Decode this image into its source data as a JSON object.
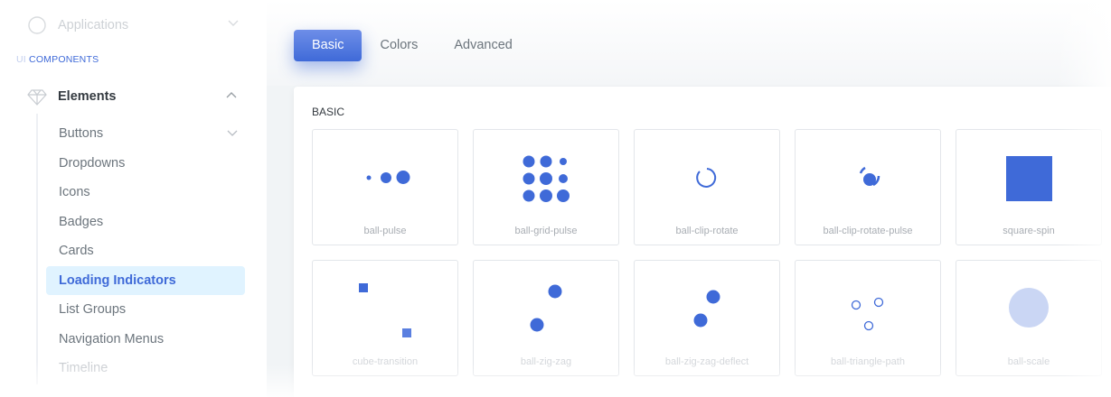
{
  "sidebar": {
    "applications_label": "Applications",
    "section_heading_prefix": "UI ",
    "section_heading_rest": "COMPONENTS",
    "elements_label": "Elements",
    "items": [
      {
        "label": "Buttons"
      },
      {
        "label": "Dropdowns"
      },
      {
        "label": "Icons"
      },
      {
        "label": "Badges"
      },
      {
        "label": "Cards"
      },
      {
        "label": "Loading Indicators"
      },
      {
        "label": "List Groups"
      },
      {
        "label": "Navigation Menus"
      },
      {
        "label": "Timeline"
      }
    ],
    "active_item": "Loading Indicators"
  },
  "tabs": [
    {
      "label": "Basic"
    },
    {
      "label": "Colors"
    },
    {
      "label": "Advanced"
    }
  ],
  "active_tab": "Basic",
  "card": {
    "title": "Basic",
    "loaders": [
      {
        "label": "ball-pulse"
      },
      {
        "label": "ball-grid-pulse"
      },
      {
        "label": "ball-clip-rotate"
      },
      {
        "label": "ball-clip-rotate-pulse"
      },
      {
        "label": "square-spin"
      },
      {
        "label": "cube-transition"
      },
      {
        "label": "ball-zig-zag"
      },
      {
        "label": "ball-zig-zag-deflect"
      },
      {
        "label": "ball-triangle-path"
      },
      {
        "label": "ball-scale"
      }
    ]
  },
  "colors": {
    "primary": "#3f6ad8",
    "active_bg": "#e0f3ff",
    "loader": "#3f6ad8"
  },
  "icons": {
    "applications": "grid-icon",
    "elements": "diamond-icon"
  }
}
